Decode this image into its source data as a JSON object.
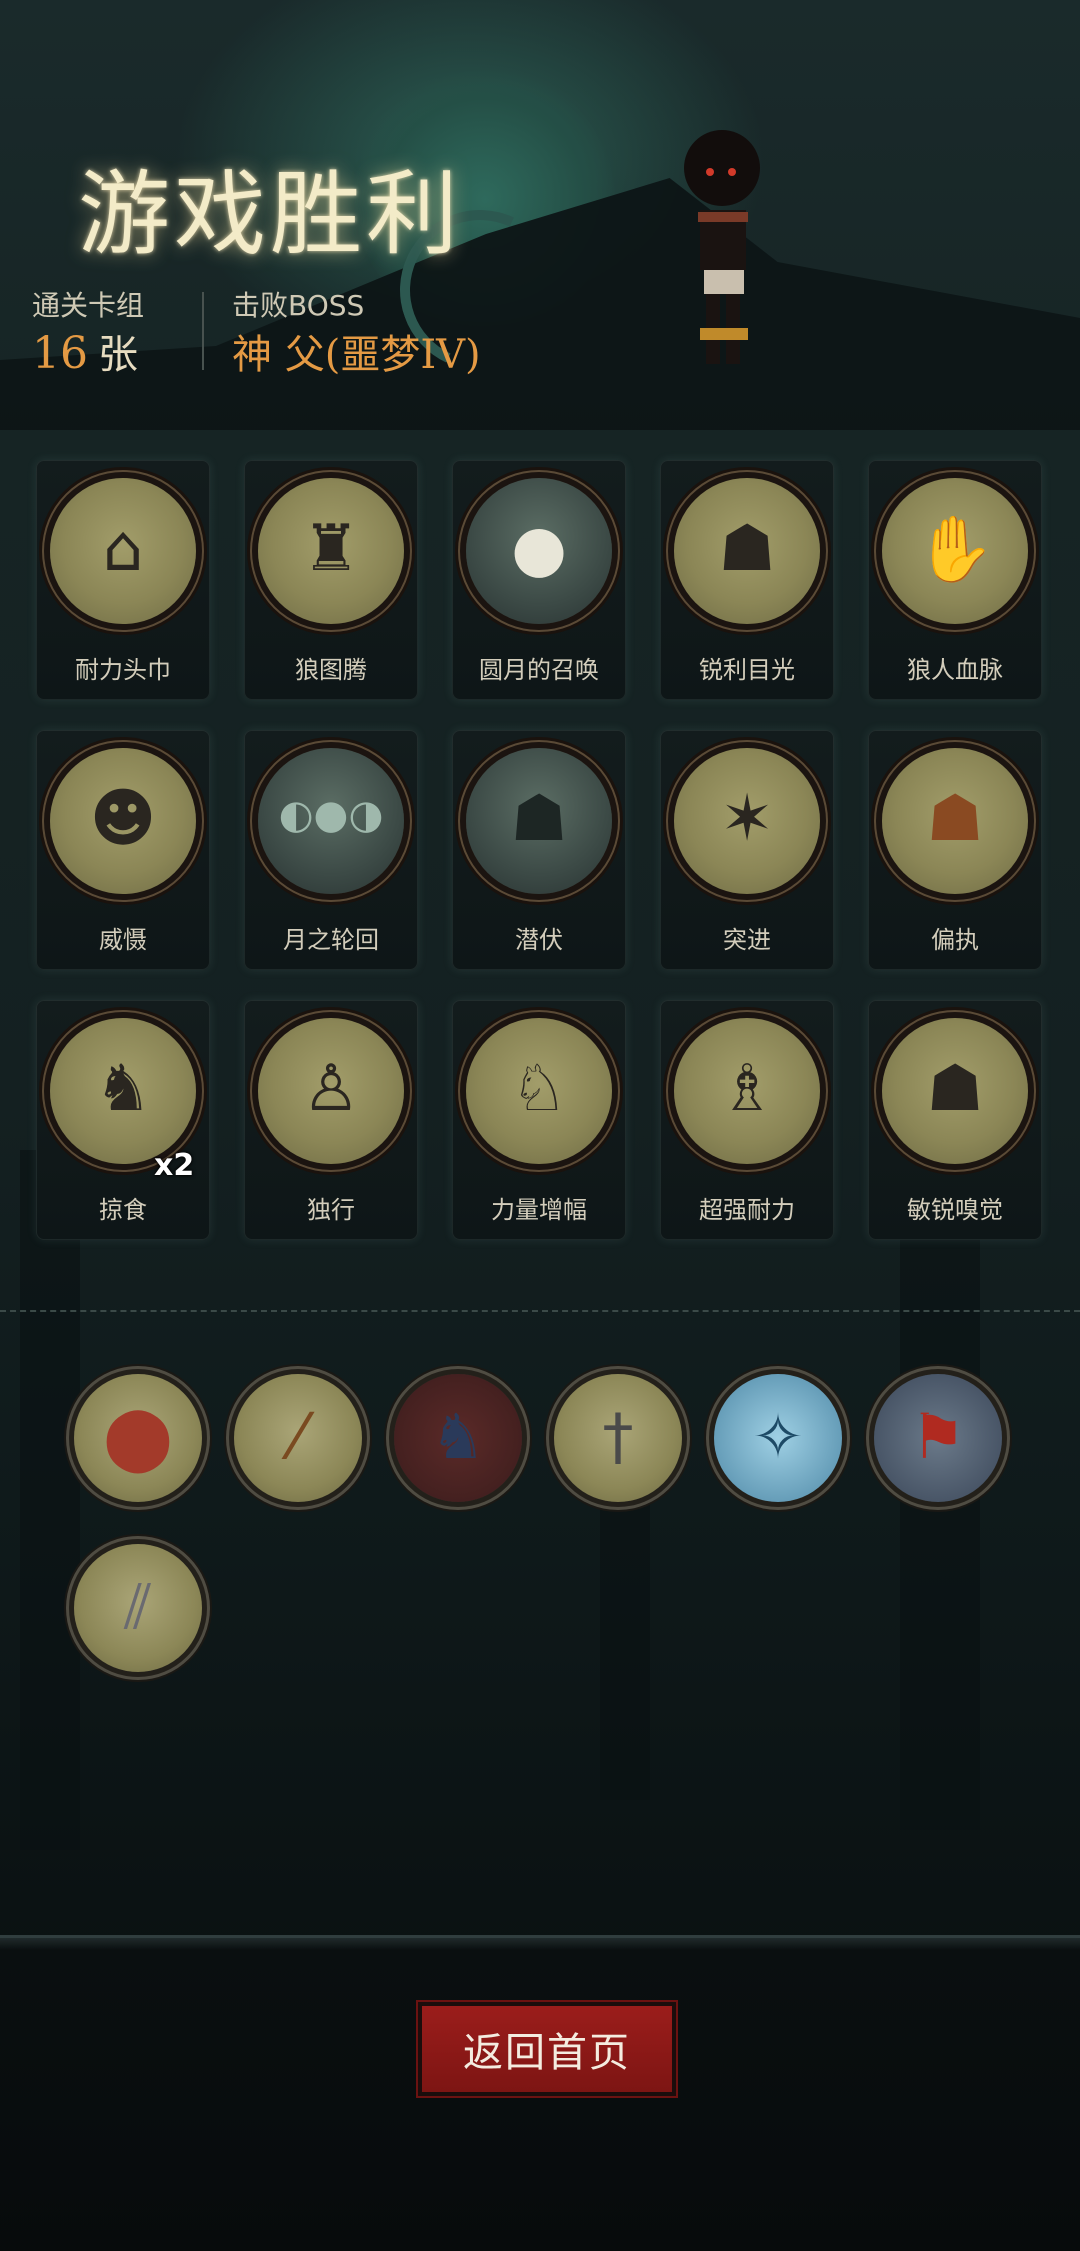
{
  "header": {
    "title": "游戏胜利",
    "cleared_deck_label": "通关卡组",
    "cleared_deck_count": "16",
    "cleared_deck_unit": "张",
    "boss_label": "击败BOSS",
    "boss_name": "神 父(噩梦IV)"
  },
  "cards": [
    {
      "label": "耐力头巾",
      "icon": "bandana-icon"
    },
    {
      "label": "狼图腾",
      "icon": "wolf-totem-icon"
    },
    {
      "label": "圆月的召唤",
      "icon": "full-moon-icon"
    },
    {
      "label": "锐利目光",
      "icon": "snarling-wolf-icon"
    },
    {
      "label": "狼人血脉",
      "icon": "reaching-hand-icon"
    },
    {
      "label": "威慑",
      "icon": "bear-icon"
    },
    {
      "label": "月之轮回",
      "icon": "moon-phases-icon"
    },
    {
      "label": "潜伏",
      "icon": "lurking-wolf-icon"
    },
    {
      "label": "突进",
      "icon": "lunging-werewolf-icon"
    },
    {
      "label": "偏执",
      "icon": "wolf-vs-bear-icon"
    },
    {
      "label": "掠食",
      "icon": "werewolf-prey-icon",
      "count": "x2"
    },
    {
      "label": "独行",
      "icon": "boy-with-stick-icon"
    },
    {
      "label": "力量增幅",
      "icon": "boy-carrying-log-icon"
    },
    {
      "label": "超强耐力",
      "icon": "boy-swinging-icon"
    },
    {
      "label": "敏锐嗅觉",
      "icon": "sniffing-wolf-icon"
    }
  ],
  "relics": [
    {
      "icon": "cookie-relic-icon"
    },
    {
      "icon": "spyglass-relic-icon"
    },
    {
      "icon": "werewolf-relic-icon"
    },
    {
      "icon": "dagger-relic-icon"
    },
    {
      "icon": "compass-relic-icon"
    },
    {
      "icon": "cloak-relic-icon"
    },
    {
      "icon": "throwing-knives-relic-icon"
    }
  ],
  "footer": {
    "home_button": "返回首页"
  },
  "colors": {
    "accent_orange": "#e49a44",
    "button_red": "#8a1816"
  }
}
